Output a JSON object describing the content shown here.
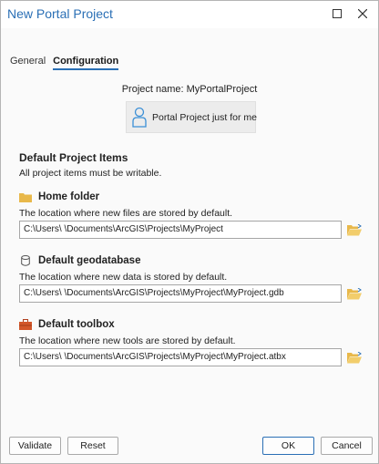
{
  "window": {
    "title": "New Portal Project"
  },
  "tabs": [
    {
      "label": "General"
    },
    {
      "label": "Configuration"
    }
  ],
  "project": {
    "name_label": "Project name: MyPortalProject",
    "template_label": "Portal Project just for me"
  },
  "defaults": {
    "title": "Default Project Items",
    "subtitle": "All project items must be writable."
  },
  "items": [
    {
      "title": "Home folder",
      "desc": "The location where new files are stored by default.",
      "path": "C:\\Users\\        \\Documents\\ArcGIS\\Projects\\MyProject",
      "icon": "folder-icon"
    },
    {
      "title": "Default geodatabase",
      "desc": "The location where new data is stored by default.",
      "path": "C:\\Users\\        \\Documents\\ArcGIS\\Projects\\MyProject\\MyProject.gdb",
      "icon": "geodatabase-icon"
    },
    {
      "title": "Default toolbox",
      "desc": "The location where new tools are stored by default.",
      "path": "C:\\Users\\        \\Documents\\ArcGIS\\Projects\\MyProject\\MyProject.atbx",
      "icon": "toolbox-icon"
    }
  ],
  "buttons": {
    "validate": "Validate",
    "reset": "Reset",
    "ok": "OK",
    "cancel": "Cancel"
  },
  "colors": {
    "accent": "#2a6fb5",
    "folder": "#e8b84a",
    "toolbox": "#d2572b"
  }
}
